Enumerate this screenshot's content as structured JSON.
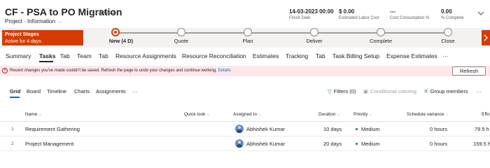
{
  "header": {
    "title": "CF - PSA to PO Migration",
    "saved": "- Saved",
    "entity": "Project",
    "separator": "·",
    "form": "Information",
    "finish_date": {
      "value": "14-03-2023 00:00",
      "label": "Finish Date"
    },
    "labor_cost": {
      "value": "$ 0.00",
      "label": "Estimated Labor Cost"
    },
    "cost_consumption": {
      "value": "---",
      "label": "Cost Consumption %"
    },
    "complete": {
      "value": "0.00",
      "label": "% Complete"
    },
    "expand_icon": "chevron-down-icon"
  },
  "bpf": {
    "stage_title": "Project Stages",
    "stage_sub": "Active for 4 days",
    "stages": [
      {
        "label": "New  (4 D)",
        "active": true
      },
      {
        "label": "Quote",
        "active": false
      },
      {
        "label": "Plan",
        "active": false
      },
      {
        "label": "Deliver",
        "active": false
      },
      {
        "label": "Complete",
        "active": false
      },
      {
        "label": "Close",
        "active": false
      }
    ],
    "left_arrow": "chevron-left-icon",
    "right_arrow": "chevron-right-icon",
    "colors": {
      "accent": "#d83b01"
    }
  },
  "tabs": [
    "Summary",
    "Tasks",
    "Tab",
    "Team",
    "Tab",
    "Resource Assignments",
    "Resource Reconciliation",
    "Estimates",
    "Tracking",
    "Tab",
    "Task Billing Setup",
    "Expense Estimates",
    "···"
  ],
  "active_tab": "Tasks",
  "notice": {
    "text": "Recent changes you've made couldn't be saved. Refresh the page to undo your changes and continue working.",
    "link": "Details",
    "button": "Refresh",
    "icon": "error-circle-icon"
  },
  "subtabs": [
    "Grid",
    "Board",
    "Timeline",
    "Charts",
    "Assignments",
    "···"
  ],
  "active_subtab": "Grid",
  "tools": {
    "filters": "Filters (0)",
    "conditional": "Conditional coloring",
    "group": "Group members",
    "more": "···"
  },
  "grid": {
    "columns": [
      "Name",
      "Quick look",
      "Assigned to",
      "Duration",
      "Priority",
      "Schedule variance",
      "Effo"
    ],
    "rows": [
      {
        "num": "1",
        "name": "Requirement Gathering",
        "assigned": "Abhishek Kumar",
        "duration": "10 days",
        "priority": "Medium",
        "variance": "0 hours",
        "effort": "79.5 h"
      },
      {
        "num": "2",
        "name": "Project Management",
        "assigned": "Abhishek Kumar",
        "duration": "20 days",
        "priority": "Medium",
        "variance": "0 hours",
        "effort": "159.5 h"
      }
    ]
  }
}
